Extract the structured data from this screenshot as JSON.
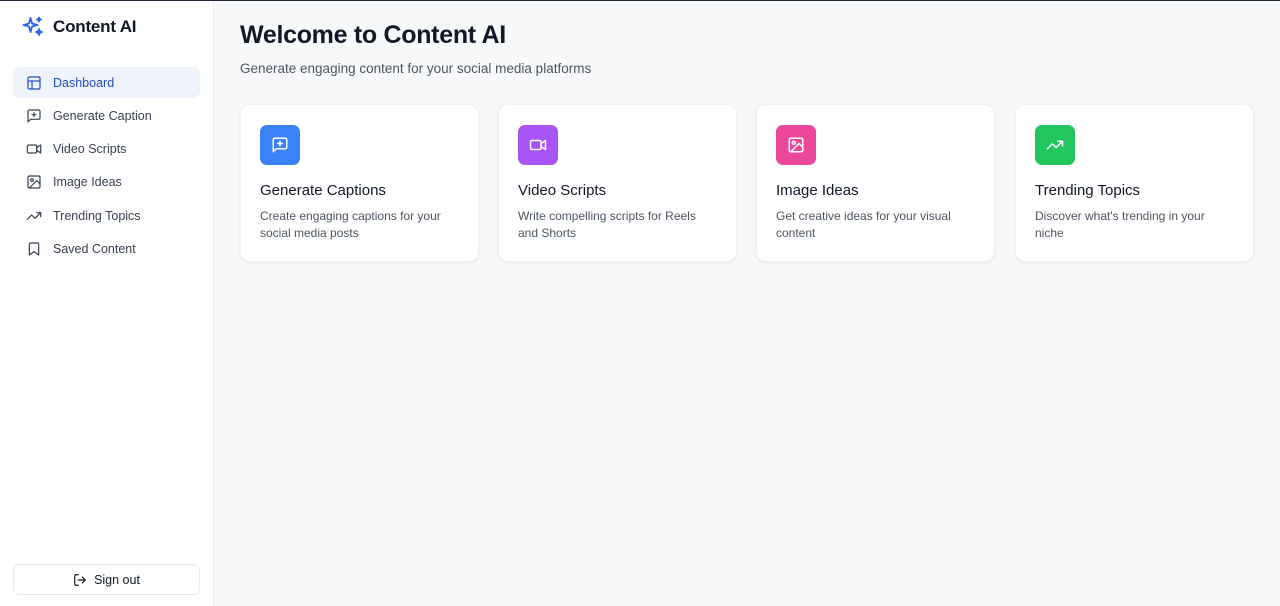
{
  "app": {
    "name": "Content AI"
  },
  "sidebar": {
    "items": [
      {
        "label": "Dashboard",
        "icon": "layout-icon",
        "active": true
      },
      {
        "label": "Generate Caption",
        "icon": "message-plus-icon"
      },
      {
        "label": "Video Scripts",
        "icon": "video-icon"
      },
      {
        "label": "Image Ideas",
        "icon": "image-icon"
      },
      {
        "label": "Trending Topics",
        "icon": "trending-up-icon"
      },
      {
        "label": "Saved Content",
        "icon": "bookmark-icon"
      }
    ],
    "signout_label": "Sign out"
  },
  "main": {
    "title": "Welcome to Content AI",
    "subtitle": "Generate engaging content for your social media platforms",
    "cards": [
      {
        "title": "Generate Captions",
        "description": "Create engaging captions for your social media posts",
        "icon": "message-plus-icon",
        "color": "#3b82f6"
      },
      {
        "title": "Video Scripts",
        "description": "Write compelling scripts for Reels and Shorts",
        "icon": "video-icon",
        "color": "#a855f7"
      },
      {
        "title": "Image Ideas",
        "description": "Get creative ideas for your visual content",
        "icon": "image-icon",
        "color": "#ec4899"
      },
      {
        "title": "Trending Topics",
        "description": "Discover what's trending in your niche",
        "icon": "trending-up-icon",
        "color": "#22c55e"
      }
    ]
  },
  "colors": {
    "brand": "#1e4fbd",
    "active_nav_bg": "#eef3fc"
  }
}
